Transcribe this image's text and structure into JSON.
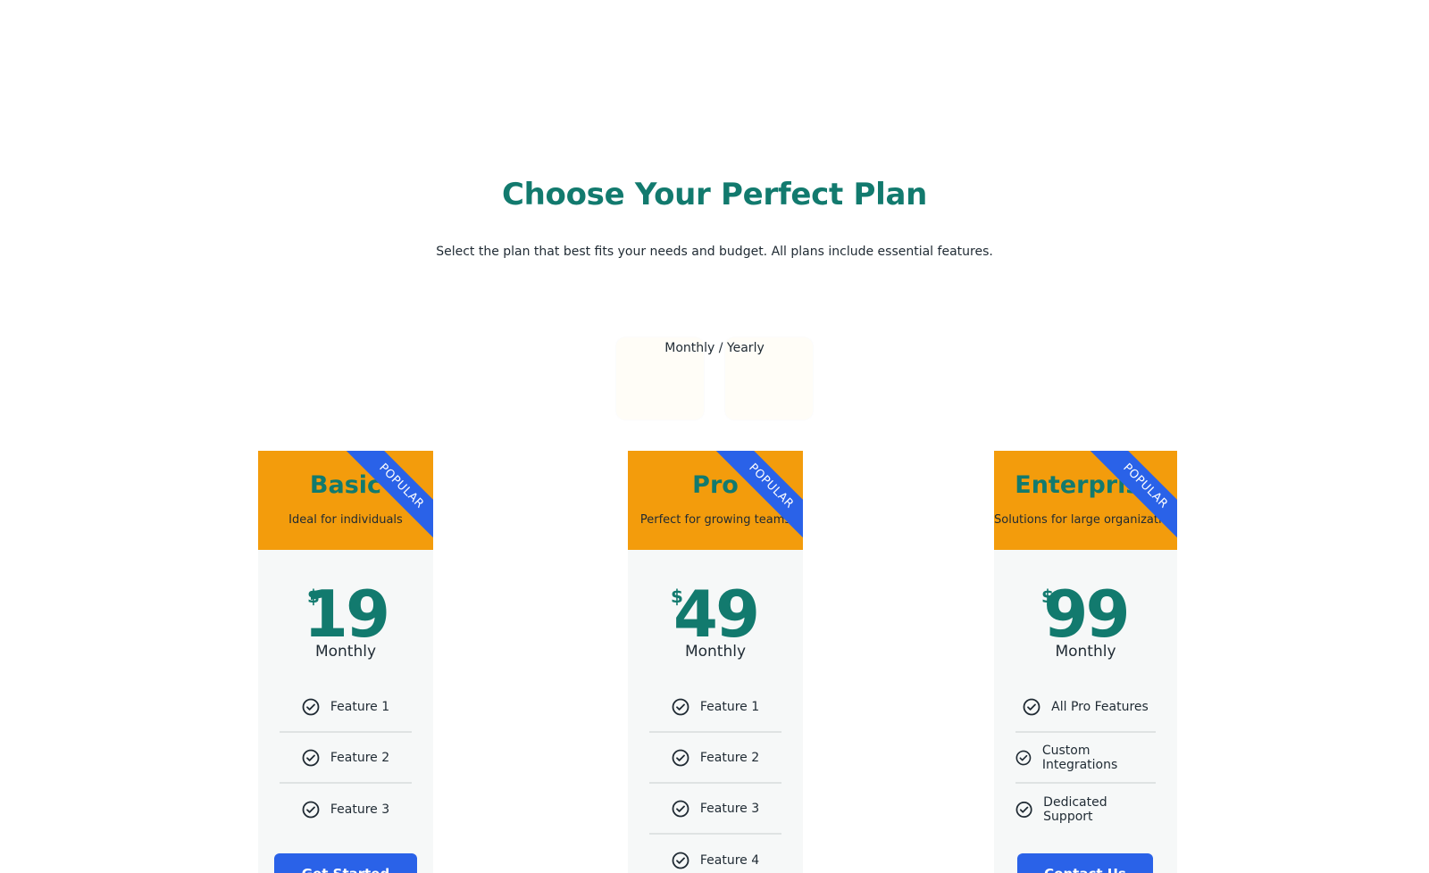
{
  "header": {
    "title": "Choose Your Perfect Plan",
    "subtitle": "Select the plan that best fits your needs and budget. All plans include essential features."
  },
  "toggle": {
    "label": "Monthly / Yearly"
  },
  "plans": [
    {
      "name": "Basic",
      "description": "Ideal for individuals",
      "ribbon": "POPULAR",
      "currency": "$",
      "price": "19",
      "period": "Monthly",
      "features": [
        "Feature 1",
        "Feature 2",
        "Feature 3"
      ],
      "cta": "Get Started"
    },
    {
      "name": "Pro",
      "description": "Perfect for growing teams",
      "ribbon": "POPULAR",
      "currency": "$",
      "price": "49",
      "period": "Monthly",
      "features": [
        "Feature 1",
        "Feature 2",
        "Feature 3",
        "Feature 4"
      ],
      "cta": ""
    },
    {
      "name": "Enterprise",
      "description": "Solutions for large organizations",
      "ribbon": "POPULAR",
      "currency": "$",
      "price": "99",
      "period": "Monthly",
      "features": [
        "All Pro Features",
        "Custom Integrations",
        "Dedicated Support"
      ],
      "cta": "Contact Us"
    }
  ],
  "colors": {
    "title": "#127a6e",
    "card_header": "#f39c0c",
    "ribbon": "#2a62e8",
    "button": "#2a62e8",
    "card_body": "#f6f8f8"
  },
  "icons": {
    "feature": "check-circle-icon"
  }
}
